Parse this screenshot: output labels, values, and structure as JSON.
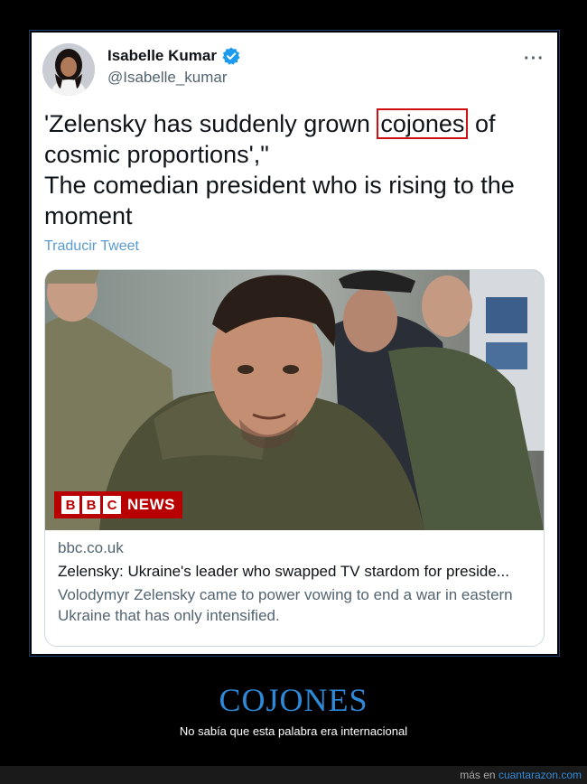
{
  "tweet": {
    "author_name": "Isabelle Kumar",
    "author_handle": "@Isabelle_kumar",
    "more_label": "···",
    "text_before": "'Zelensky has suddenly grown ",
    "text_highlight": "cojones",
    "text_after": " of cosmic proportions',\"",
    "text_line2": "The comedian president who is rising to the moment",
    "translate_label": "Traducir Tweet",
    "colors": {
      "verified": "#1d9bf0",
      "highlight_box": "#d01010",
      "translate": "#5a9ad0"
    }
  },
  "card": {
    "logo_letters": [
      "B",
      "B",
      "C"
    ],
    "logo_news": "NEWS",
    "domain": "bbc.co.uk",
    "title": "Zelensky: Ukraine's leader who swapped TV stardom for preside...",
    "description": "Volodymyr Zelensky came to power vowing to end a war in eastern Ukraine that has only intensified."
  },
  "caption": {
    "title": "COJONES",
    "subtitle": "No sabía que esta palabra era internacional"
  },
  "footer": {
    "prefix": "más en",
    "link": "cuantarazon.com"
  }
}
